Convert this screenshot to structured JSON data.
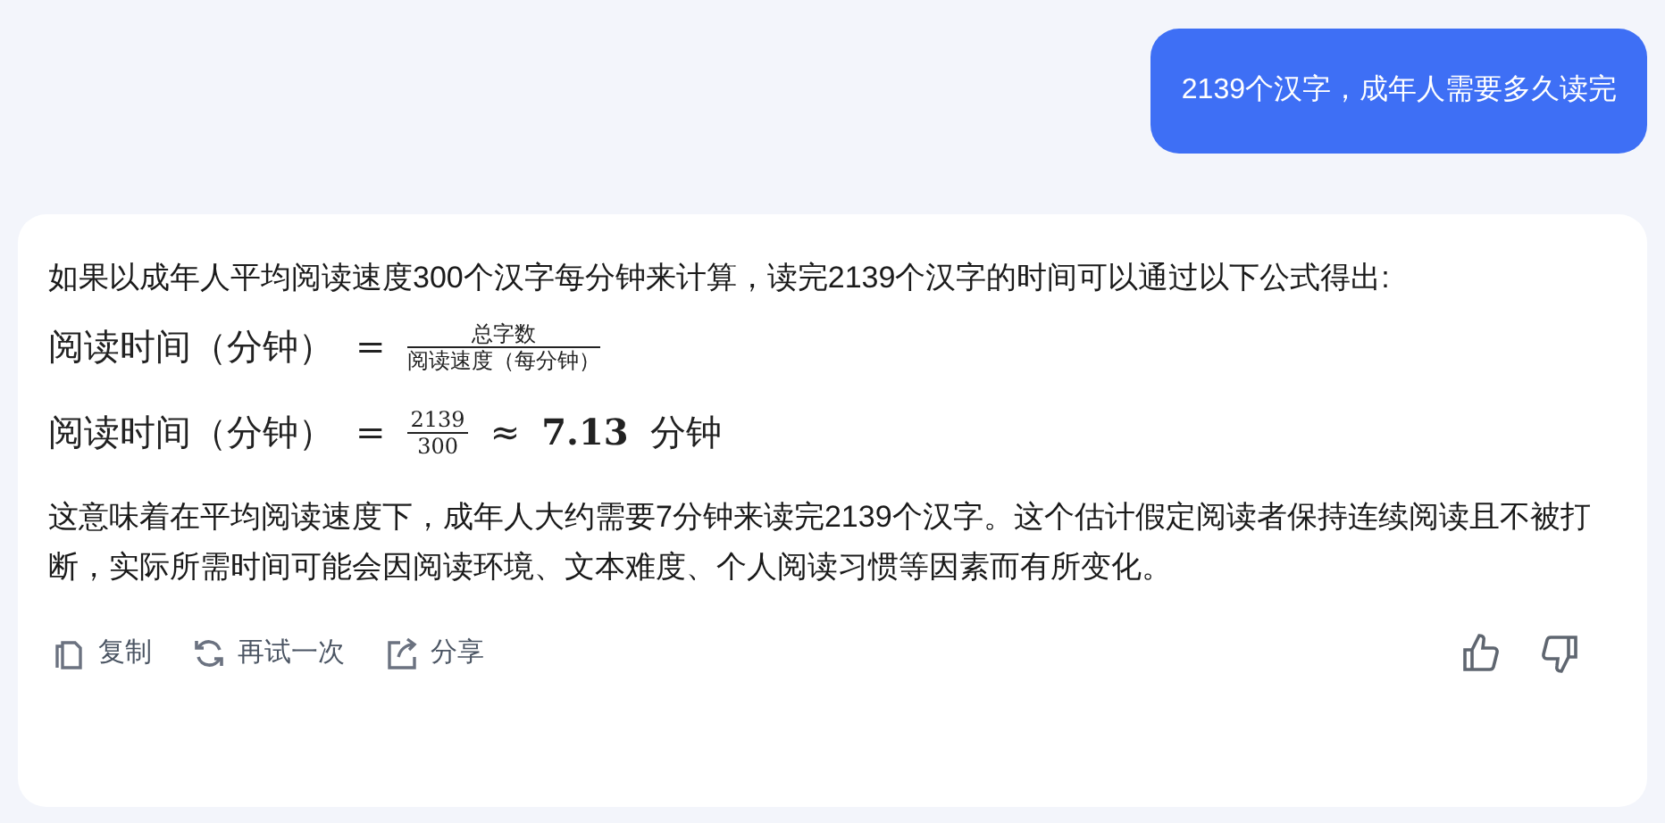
{
  "user_message": "2139个汉字，成年人需要多久读完",
  "answer": {
    "intro": "如果以成年人平均阅读速度300个汉字每分钟来计算，读完2139个汉字的时间可以通过以下公式得出:",
    "formulas": [
      {
        "lhs": "阅读时间（分钟）",
        "eq": "=",
        "numerator": "总字数",
        "denominator": "阅读速度（每分钟）"
      },
      {
        "lhs": "阅读时间（分钟）",
        "eq": "=",
        "numerator": "2139",
        "denominator": "300",
        "tail": [
          {
            "kind": "op",
            "text": "≈"
          },
          {
            "kind": "bold",
            "text": "7.13"
          },
          {
            "kind": "plain",
            "text": "分钟"
          }
        ]
      }
    ],
    "conclusion": "这意味着在平均阅读速度下，成年人大约需要7分钟来读完2139个汉字。这个估计假定阅读者保持连续阅读且不被打断，实际所需时间可能会因阅读环境、文本难度、个人阅读习惯等因素而有所变化。",
    "actions": [
      {
        "kind": "copy",
        "label": "复制"
      },
      {
        "kind": "retry",
        "label": "再试一次"
      },
      {
        "kind": "share",
        "label": "分享"
      }
    ]
  }
}
